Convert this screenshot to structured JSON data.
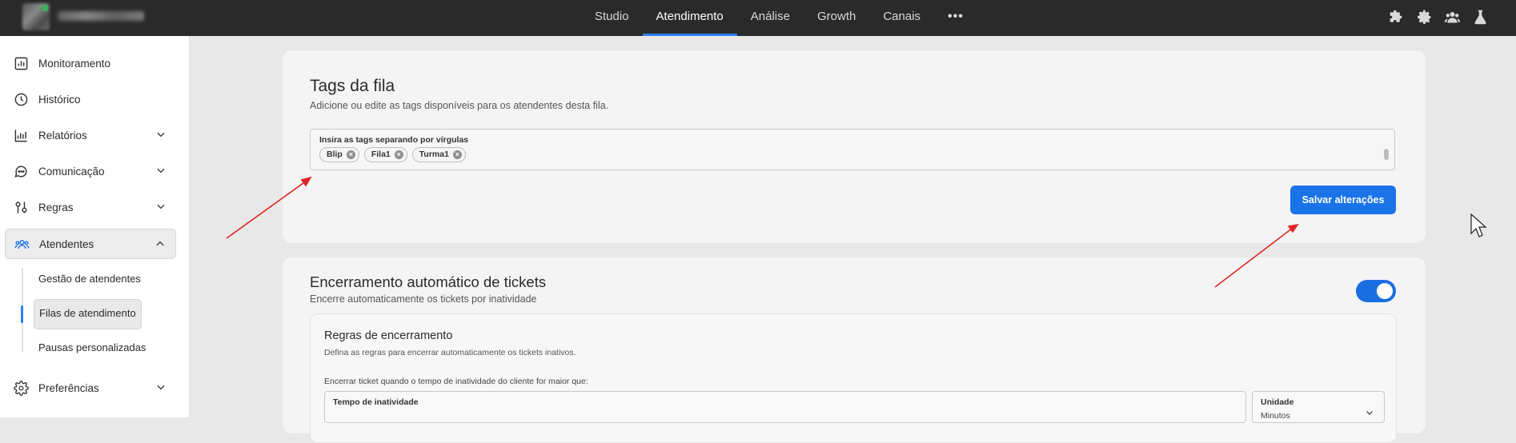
{
  "topbar": {
    "nav": [
      "Studio",
      "Atendimento",
      "Análise",
      "Growth",
      "Canais"
    ],
    "active": "Atendimento",
    "more_label": "•••",
    "icons": [
      "puzzle-icon",
      "gear-icon",
      "team-icon",
      "flask-icon"
    ]
  },
  "sidebar": {
    "items": [
      {
        "label": "Monitoramento",
        "icon": "monitor-icon"
      },
      {
        "label": "Histórico",
        "icon": "clock-icon"
      },
      {
        "label": "Relatórios",
        "icon": "chart-icon"
      },
      {
        "label": "Comunicação",
        "icon": "chat-icon"
      },
      {
        "label": "Regras",
        "icon": "rules-icon"
      },
      {
        "label": "Atendentes",
        "icon": "users-icon"
      },
      {
        "label": "Preferências",
        "icon": "gear-icon"
      }
    ],
    "subitems": [
      "Gestão de atendentes",
      "Filas de atendimento",
      "Pausas personalizadas"
    ],
    "active_subitem": "Filas de atendimento"
  },
  "tags_card": {
    "title": "Tags da fila",
    "subtitle": "Adicione ou edite as tags disponíveis para os atendentes desta fila.",
    "field_label": "Insira as tags separando por vírgulas",
    "tags": [
      "Blip",
      "Fila1",
      "Turma1"
    ],
    "save_label": "Salvar alterações"
  },
  "auto_close_card": {
    "title": "Encerramento automático de tickets",
    "subtitle": "Encerre automaticamente os tickets por inatividade",
    "toggle_on": true,
    "rules": {
      "title": "Regras de encerramento",
      "subtitle": "Defina as regras para encerrar automaticamente os tickets inativos.",
      "question": "Encerrar ticket quando o tempo de inatividade do cliente for maior que:",
      "time_label": "Tempo de inatividade",
      "unit_label": "Unidade",
      "unit_value": "Minutos"
    }
  },
  "colors": {
    "topbar_bg": "#2a2a2a",
    "accent": "#1a73e8",
    "annotation_arrow": "#e02424"
  }
}
